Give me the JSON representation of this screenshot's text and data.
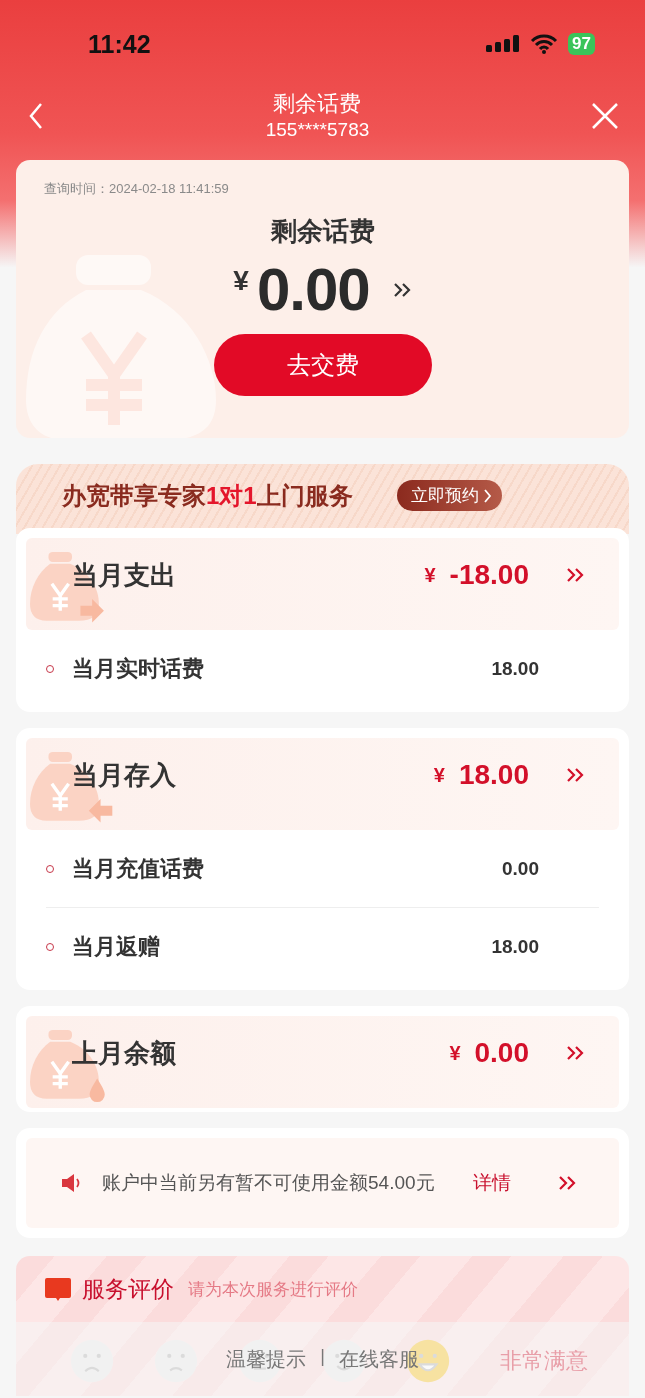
{
  "status_bar": {
    "time": "11:42",
    "battery": "97"
  },
  "header": {
    "title": "剩余话费",
    "subtitle": "155****5783"
  },
  "balance_card": {
    "query_label": "查询时间：",
    "query_time": "2024-02-18 11:41:59",
    "title": "剩余话费",
    "currency": "¥",
    "amount": "0.00",
    "pay_button": "去交费"
  },
  "promo_banner": {
    "text_before": "办宽带享专家",
    "highlight": "1对1",
    "text_after": "上门服务",
    "button": "立即预约"
  },
  "sections": [
    {
      "kind": "out",
      "title": "当月支出",
      "currency": "¥",
      "amount": "-18.00",
      "items": [
        {
          "label": "当月实时话费",
          "value": "18.00"
        }
      ]
    },
    {
      "kind": "in",
      "title": "当月存入",
      "currency": "¥",
      "amount": "18.00",
      "items": [
        {
          "label": "当月充值话费",
          "value": "0.00"
        },
        {
          "label": "当月返赠",
          "value": "18.00"
        }
      ]
    },
    {
      "kind": "balance",
      "title": "上月余额",
      "currency": "¥",
      "amount": "0.00"
    }
  ],
  "notice": {
    "text": "账户中当前另有暂不可使用金额54.00元",
    "link": "详情"
  },
  "rating": {
    "title": "服务评价",
    "hint": "请为本次服务进行评价",
    "options": [
      {
        "selected": false
      },
      {
        "selected": false
      },
      {
        "selected": false
      },
      {
        "selected": false
      },
      {
        "selected": true
      }
    ],
    "selected_label": "非常满意"
  },
  "footer": {
    "links": [
      "温馨提示",
      "在线客服"
    ],
    "separator": "|"
  }
}
